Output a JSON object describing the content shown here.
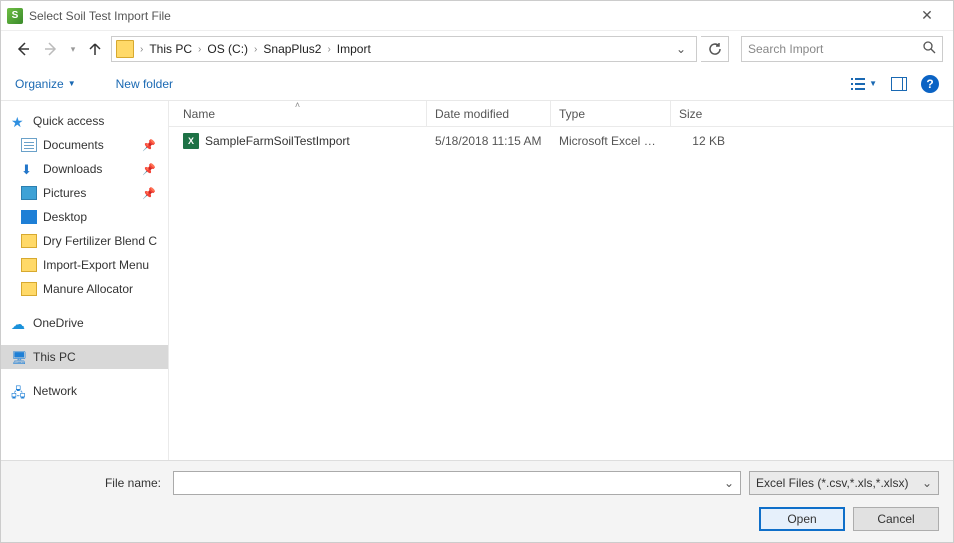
{
  "window": {
    "title": "Select Soil Test Import File"
  },
  "breadcrumb": {
    "items": [
      "This PC",
      "OS (C:)",
      "SnapPlus2",
      "Import"
    ]
  },
  "search": {
    "placeholder": "Search Import"
  },
  "toolbar": {
    "organize": "Organize",
    "newfolder": "New folder"
  },
  "sidebar": {
    "quick_access": "Quick access",
    "quick_items": [
      {
        "label": "Documents",
        "pinned": true,
        "icon": "doc"
      },
      {
        "label": "Downloads",
        "pinned": true,
        "icon": "down"
      },
      {
        "label": "Pictures",
        "pinned": true,
        "icon": "pic"
      },
      {
        "label": "Desktop",
        "pinned": false,
        "icon": "desktop"
      },
      {
        "label": "Dry Fertilizer Blend C",
        "pinned": false,
        "icon": "folder"
      },
      {
        "label": "Import-Export Menu",
        "pinned": false,
        "icon": "folder"
      },
      {
        "label": "Manure Allocator",
        "pinned": false,
        "icon": "folder"
      }
    ],
    "onedrive": "OneDrive",
    "thispc": "This PC",
    "network": "Network"
  },
  "columns": {
    "name": "Name",
    "date": "Date modified",
    "type": "Type",
    "size": "Size"
  },
  "files": [
    {
      "name": "SampleFarmSoilTestImport",
      "date": "5/18/2018 11:15 AM",
      "type": "Microsoft Excel W...",
      "size": "12 KB"
    }
  ],
  "footer": {
    "filename_label": "File name:",
    "filename_value": "",
    "filter": "Excel Files (*.csv,*.xls,*.xlsx)",
    "open": "Open",
    "cancel": "Cancel"
  },
  "help_glyph": "?"
}
